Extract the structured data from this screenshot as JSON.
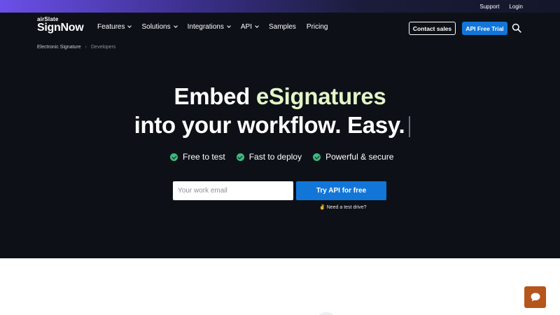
{
  "topbar": {
    "support": "Support",
    "login": "Login"
  },
  "brand": {
    "small": "airSlate",
    "big": "SignNow"
  },
  "nav": {
    "items": [
      {
        "label": "Features",
        "has_dropdown": true
      },
      {
        "label": "Solutions",
        "has_dropdown": true
      },
      {
        "label": "Integrations",
        "has_dropdown": true
      },
      {
        "label": "API",
        "has_dropdown": true
      },
      {
        "label": "Samples",
        "has_dropdown": false
      },
      {
        "label": "Pricing",
        "has_dropdown": false
      }
    ],
    "contact_sales": "Contact sales",
    "api_free_trial": "API Free Trial",
    "search_icon": "search-icon"
  },
  "breadcrumb": {
    "items": [
      "Electronic Signature",
      "Developers"
    ],
    "separator": "›"
  },
  "hero": {
    "headline_1_plain": "Embed ",
    "headline_1_accent": "eSignatures",
    "headline_2": "into your workflow. Easy.",
    "features": [
      "Free to test",
      "Fast to deploy",
      "Powerful & secure"
    ],
    "email_placeholder": "Your work email",
    "email_value": "",
    "cta": "Try API for free",
    "test_drive_emoji": "✌",
    "test_drive": "Need a test drive?"
  },
  "colors": {
    "hero_bg": "#0d1117",
    "accent_text": "#e4f5c8",
    "primary_blue": "#1276d9",
    "check_green": "#3fb87f",
    "chat_orange": "#b5561c"
  },
  "chat": {
    "icon": "chat-bubble-icon"
  }
}
